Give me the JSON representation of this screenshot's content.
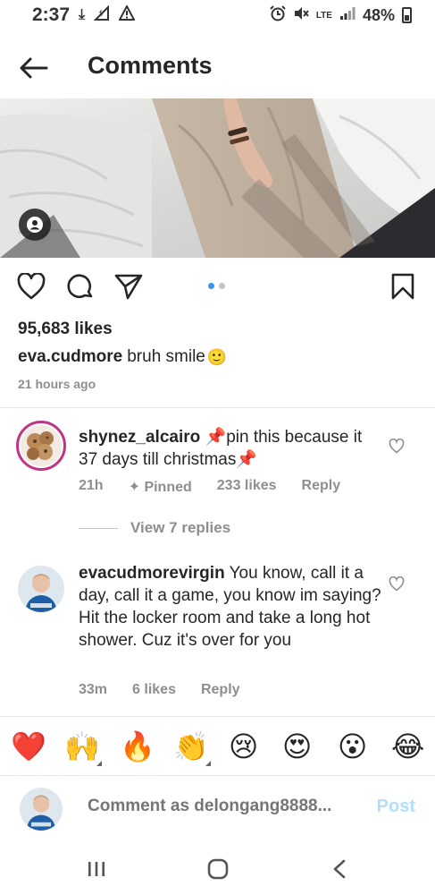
{
  "status_bar": {
    "time": "2:37",
    "battery": "48%",
    "network": "LTE",
    "icons": [
      "download-icon",
      "signal-bolt-icon",
      "warning-icon",
      "alarm-icon",
      "mute-icon",
      "signal-icon",
      "battery-icon"
    ]
  },
  "header": {
    "title": "Comments",
    "back_icon": "arrow-left-icon"
  },
  "post": {
    "likes": "95,683 likes",
    "caption_user": "eva.cudmore",
    "caption_text": "bruh smile",
    "caption_emoji": "🙂",
    "time_ago": "21 hours ago",
    "carousel_count": 2,
    "carousel_active": 0,
    "accent": "#3897f0"
  },
  "comments": [
    {
      "user": "shynez_alcairo",
      "text": "📌pin this because it 37 days till christmas📌",
      "time": "21h",
      "pinned_label": "Pinned",
      "likes": "233 likes",
      "reply_label": "Reply",
      "view_replies": "View 7 replies"
    },
    {
      "user": "evacudmorevirgin",
      "text": "You know, call it a day, call it a game, you know im saying? Hit the locker room and take a long hot shower. Cuz it's over for you",
      "time": "33m",
      "likes": "6 likes",
      "reply_label": "Reply"
    }
  ],
  "emoji_bar": [
    "❤️",
    "🙌",
    "🔥",
    "👏",
    "😢",
    "😍",
    "😮",
    "😂"
  ],
  "compose": {
    "placeholder": "Comment as delongang8888...",
    "post_label": "Post",
    "post_color": "#b2dffc"
  }
}
